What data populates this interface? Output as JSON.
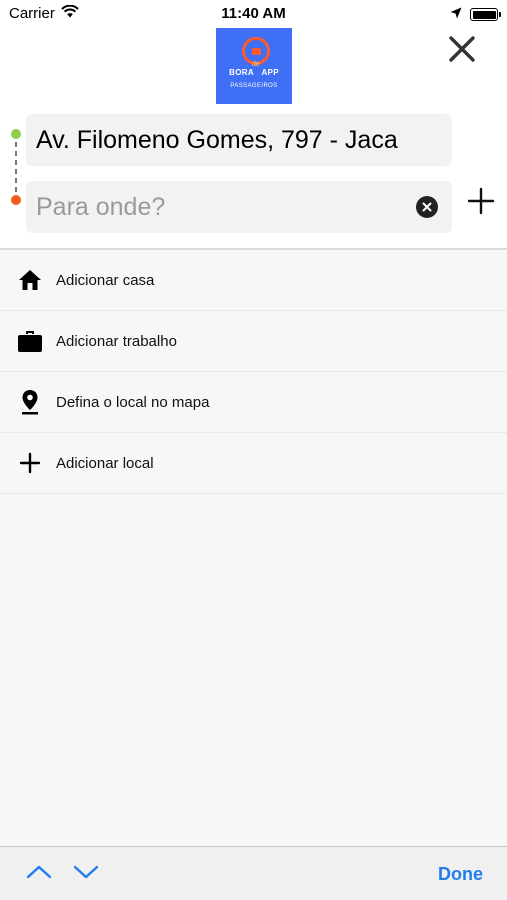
{
  "status_bar": {
    "carrier": "Carrier",
    "time": "11:40 AM"
  },
  "logo": {
    "wordmark_left": "BORA",
    "wordmark_de": "de",
    "wordmark_right": "APP",
    "subtitle": "PASSAGEIROS",
    "colors": {
      "background": "#3f6ff5",
      "accent": "#ff5a2c"
    }
  },
  "route": {
    "origin_value": "Av. Filomeno Gomes, 797 - Jaca",
    "destination_placeholder": "Para onde?",
    "destination_value": "",
    "colors": {
      "origin_dot": "#8ecf45",
      "destination_dot": "#f25b1c"
    }
  },
  "shortcuts": [
    {
      "icon": "home-icon",
      "label": "Adicionar casa"
    },
    {
      "icon": "briefcase-icon",
      "label": "Adicionar trabalho"
    },
    {
      "icon": "map-pin-icon",
      "label": "Defina o local no mapa"
    },
    {
      "icon": "plus-icon",
      "label": "Adicionar local"
    }
  ],
  "keyboard_toolbar": {
    "up_icon": "chevron-up-icon",
    "down_icon": "chevron-down-icon",
    "done_label": "Done",
    "accent_color": "#1f7df0"
  }
}
